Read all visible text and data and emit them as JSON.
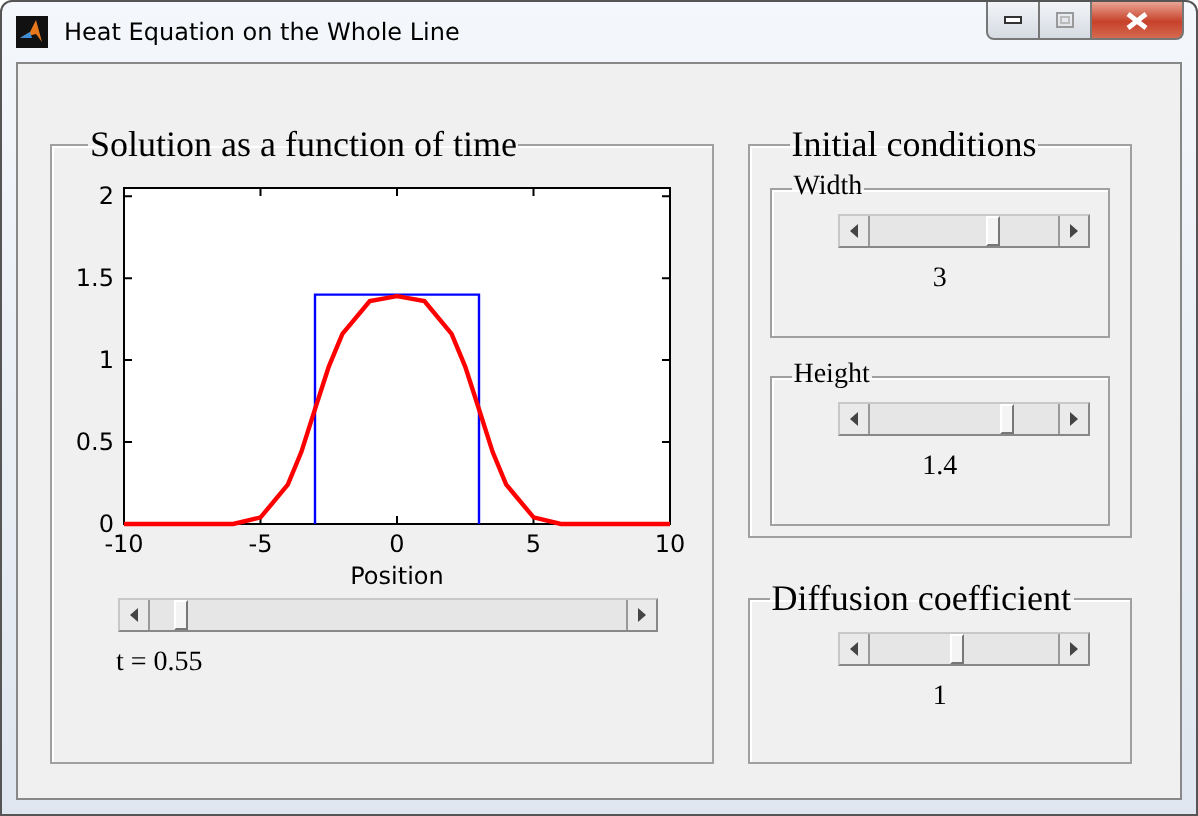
{
  "window": {
    "title": "Heat Equation on the Whole Line"
  },
  "solution_panel": {
    "title": "Solution as a function of time",
    "chart_data": {
      "type": "line",
      "xlabel": "Position",
      "x": [
        -10,
        -6,
        -5,
        -4,
        -3.5,
        -3,
        -3,
        -2.5,
        -2,
        -1,
        0,
        1,
        2,
        2.5,
        3,
        3,
        3.5,
        4,
        5,
        6,
        10
      ],
      "xlim": [
        -10,
        10
      ],
      "ylim": [
        0,
        2.05
      ],
      "xticks": [
        -10,
        -5,
        0,
        5,
        10
      ],
      "yticks": [
        0,
        0.5,
        1,
        1.5,
        2
      ],
      "series": [
        {
          "color": "#0000ff",
          "values": [
            null,
            null,
            null,
            null,
            null,
            0,
            1.4,
            1.4,
            1.4,
            1.4,
            1.4,
            1.4,
            1.4,
            1.4,
            1.4,
            0,
            null,
            null,
            null,
            null,
            null
          ]
        },
        {
          "color": "#ff0000",
          "values": [
            0,
            0,
            0.04,
            0.24,
            0.44,
            0.7,
            0.7,
            0.96,
            1.16,
            1.36,
            1.39,
            1.36,
            1.16,
            0.96,
            0.7,
            0.7,
            0.44,
            0.24,
            0.04,
            0,
            0
          ]
        }
      ]
    },
    "time_slider": {
      "level": 0.05
    },
    "time_label": "t = 0.55"
  },
  "initial_conditions": {
    "title": "Initial conditions",
    "groups": [
      {
        "title": "Width",
        "level": 0.66,
        "reading": "3"
      },
      {
        "title": "Height",
        "level": 0.74,
        "reading": "1.4"
      }
    ]
  },
  "diffusion": {
    "title": "Diffusion coefficient",
    "level": 0.46,
    "reading": "1"
  }
}
